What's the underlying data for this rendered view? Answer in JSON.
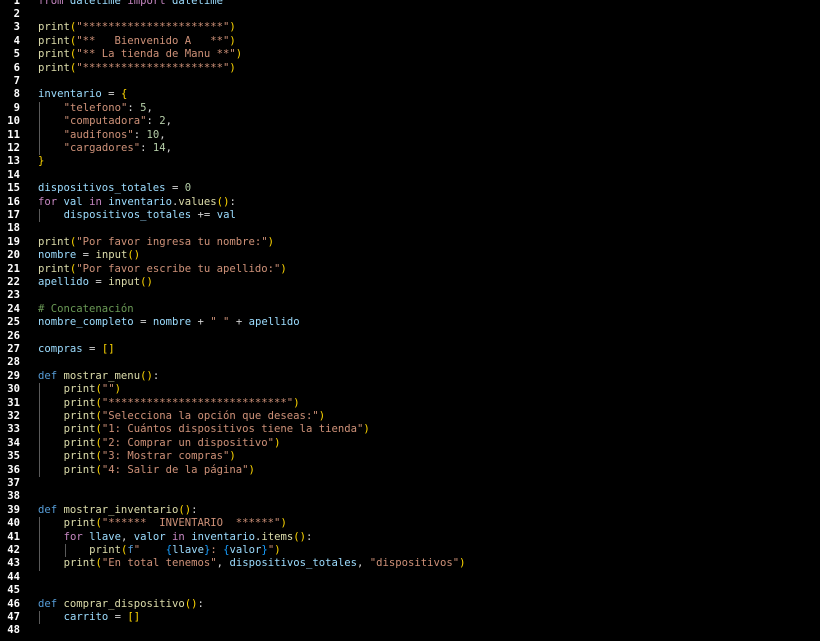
{
  "editor": {
    "language": "python",
    "lines": [
      {
        "n": "1",
        "text": "from datetime import datetime"
      },
      {
        "n": "2",
        "text": ""
      },
      {
        "n": "3",
        "text": "print(\"**********************\")"
      },
      {
        "n": "4",
        "text": "print(\"**   Bienvenido A   **\")"
      },
      {
        "n": "5",
        "text": "print(\"** La tienda de Manu **\")"
      },
      {
        "n": "6",
        "text": "print(\"**********************\")"
      },
      {
        "n": "7",
        "text": ""
      },
      {
        "n": "8",
        "text": "inventario = {"
      },
      {
        "n": "9",
        "text": "    \"telefono\": 5,"
      },
      {
        "n": "10",
        "text": "    \"computadora\": 2,"
      },
      {
        "n": "11",
        "text": "    \"audifonos\": 10,"
      },
      {
        "n": "12",
        "text": "    \"cargadores\": 14,"
      },
      {
        "n": "13",
        "text": "}"
      },
      {
        "n": "14",
        "text": ""
      },
      {
        "n": "15",
        "text": "dispositivos_totales = 0"
      },
      {
        "n": "16",
        "text": "for val in inventario.values():"
      },
      {
        "n": "17",
        "text": "    dispositivos_totales += val"
      },
      {
        "n": "18",
        "text": ""
      },
      {
        "n": "19",
        "text": "print(\"Por favor ingresa tu nombre:\")"
      },
      {
        "n": "20",
        "text": "nombre = input()"
      },
      {
        "n": "21",
        "text": "print(\"Por favor escribe tu apellido:\")"
      },
      {
        "n": "22",
        "text": "apellido = input()"
      },
      {
        "n": "23",
        "text": ""
      },
      {
        "n": "24",
        "text": "# Concatenación"
      },
      {
        "n": "25",
        "text": "nombre_completo = nombre + \" \" + apellido"
      },
      {
        "n": "26",
        "text": ""
      },
      {
        "n": "27",
        "text": "compras = []"
      },
      {
        "n": "28",
        "text": ""
      },
      {
        "n": "29",
        "text": "def mostrar_menu():"
      },
      {
        "n": "30",
        "text": "    print(\"\")"
      },
      {
        "n": "31",
        "text": "    print(\"****************************\")"
      },
      {
        "n": "32",
        "text": "    print(\"Selecciona la opción que deseas:\")"
      },
      {
        "n": "33",
        "text": "    print(\"1: Cuántos dispositivos tiene la tienda\")"
      },
      {
        "n": "34",
        "text": "    print(\"2: Comprar un dispositivo\")"
      },
      {
        "n": "35",
        "text": "    print(\"3: Mostrar compras\")"
      },
      {
        "n": "36",
        "text": "    print(\"4: Salir de la página\")"
      },
      {
        "n": "37",
        "text": ""
      },
      {
        "n": "38",
        "text": ""
      },
      {
        "n": "39",
        "text": "def mostrar_inventario():"
      },
      {
        "n": "40",
        "text": "    print(\"******  INVENTARIO  ******\")"
      },
      {
        "n": "41",
        "text": "    for llave, valor in inventario.items():"
      },
      {
        "n": "42",
        "text": "        print(f\"    {llave}: {valor}\")"
      },
      {
        "n": "43",
        "text": "    print(\"En total tenemos\", dispositivos_totales, \"dispositivos\")"
      },
      {
        "n": "44",
        "text": ""
      },
      {
        "n": "45",
        "text": ""
      },
      {
        "n": "46",
        "text": "def comprar_dispositivo():"
      },
      {
        "n": "47",
        "text": "    carrito = []"
      },
      {
        "n": "48",
        "text": ""
      }
    ]
  },
  "colors": {
    "background": "#000000",
    "keyword": "#c586c0",
    "def": "#569cd6",
    "variable": "#9cdcfe",
    "function": "#dcdcaa",
    "string": "#ce9178",
    "number": "#b5cea8",
    "comment": "#6a9955",
    "bracket_level1": "#ffd700",
    "bracket_level2": "#da70d6",
    "bracket_level3": "#179fff"
  }
}
